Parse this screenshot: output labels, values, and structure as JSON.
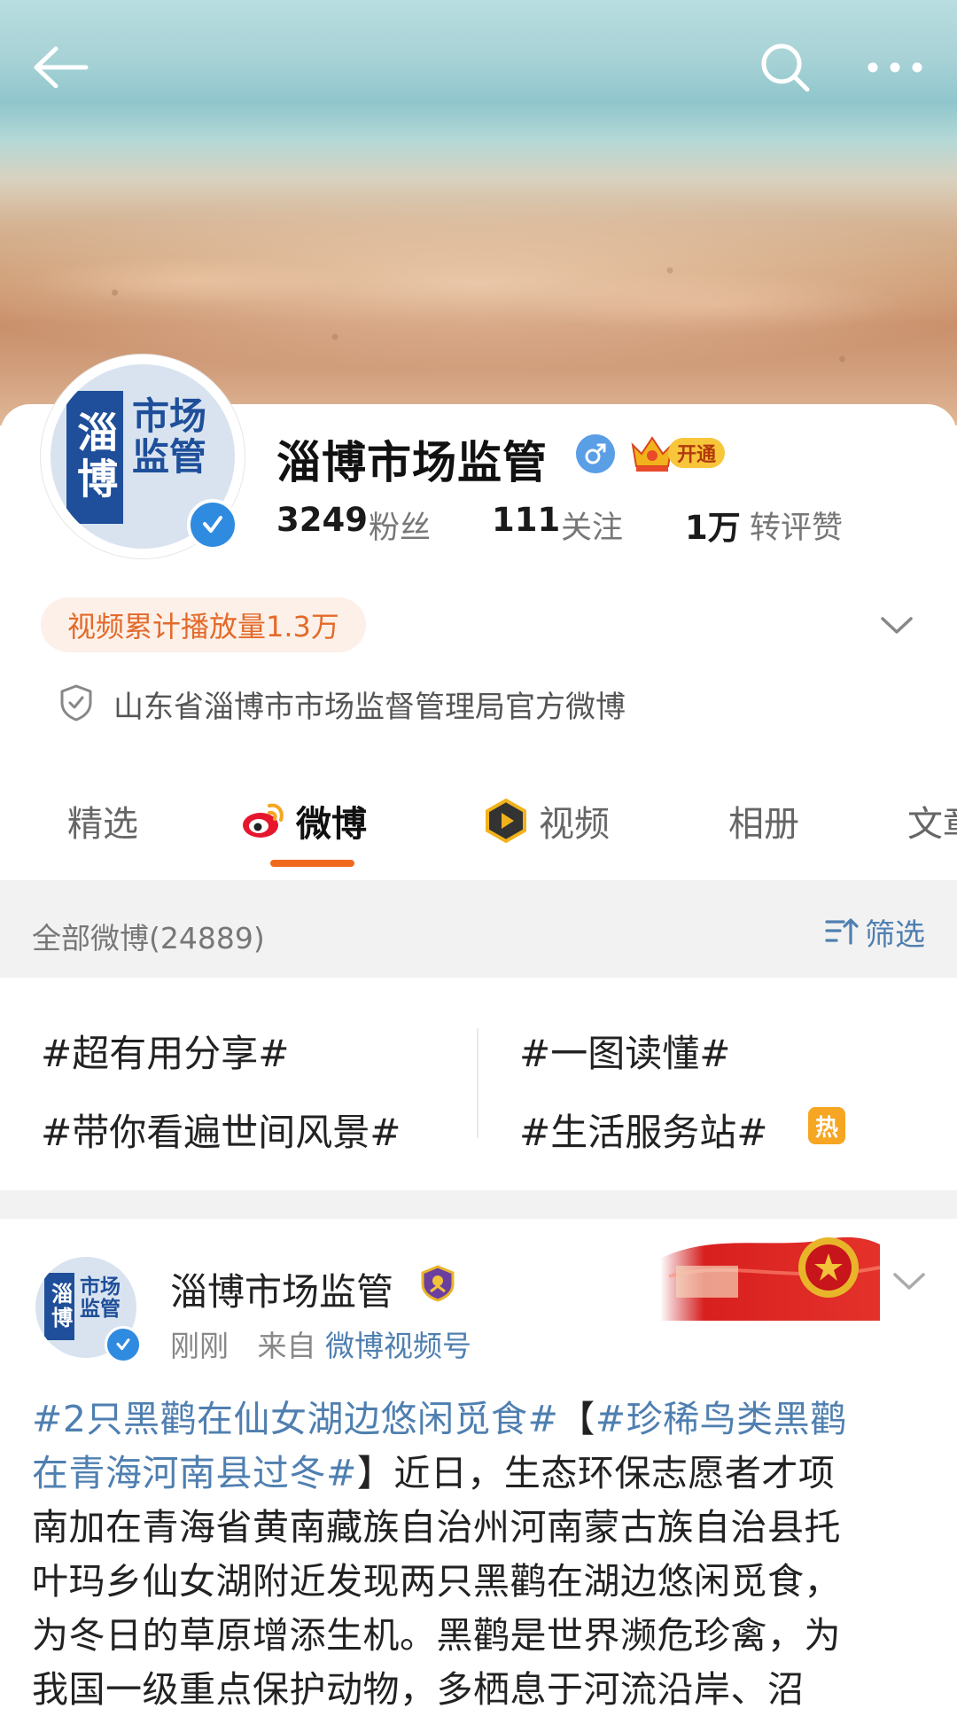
{
  "header": {
    "back_icon": "arrow-left-icon",
    "search_icon": "search-icon",
    "more_icon": "more-dots-icon"
  },
  "profile": {
    "avatar_logo_left": "淄博",
    "avatar_logo_right": "市场\n监管",
    "name": "淄博市场监管",
    "vip_label": "开通",
    "stats": [
      {
        "num": "3249",
        "label": "粉丝"
      },
      {
        "num": "111",
        "label": "关注"
      },
      {
        "num": "1万",
        "label": "转评赞"
      }
    ],
    "play_count": "视频累计播放量1.3万",
    "bio": "山东省淄博市市场监督管理局官方微博"
  },
  "tabs": [
    {
      "label": "精选",
      "active": false
    },
    {
      "label": "微博",
      "active": true
    },
    {
      "label": "视频",
      "active": false
    },
    {
      "label": "相册",
      "active": false
    },
    {
      "label": "文章",
      "active": false
    }
  ],
  "filter": {
    "title": "全部微博(24889)",
    "button": "筛选"
  },
  "topics": [
    "#超有用分享#",
    "#一图读懂#",
    "#带你看遍世间风景#",
    "#生活服务站#"
  ],
  "hot_badge": "热",
  "post": {
    "author": "淄博市场监管",
    "time": "刚刚",
    "from_label": "来自",
    "source": "微博视频号",
    "lines": [
      [
        {
          "t": "#2只黑鹳在仙女湖边悠闲觅食#",
          "link": true
        },
        {
          "t": "【",
          "link": false
        },
        {
          "t": "#珍稀鸟类黑鹳",
          "link": true
        }
      ],
      [
        {
          "t": "在青海河南县过冬#",
          "link": true
        },
        {
          "t": "】近日，生态环保志愿者才项",
          "link": false
        }
      ],
      [
        {
          "t": "南加在青海省黄南藏族自治州河南蒙古族自治县托",
          "link": false
        }
      ],
      [
        {
          "t": "叶玛乡仙女湖附近发现两只黑鹳在湖边悠闲觅食，",
          "link": false
        }
      ],
      [
        {
          "t": "为冬日的草原增添生机。黑鹳是世界濒危珍禽，为",
          "link": false
        }
      ],
      [
        {
          "t": "我国一级重点保护动物，多栖息于河流沿岸、沼",
          "link": false
        }
      ]
    ]
  },
  "colors": {
    "accent_orange": "#f06a1e",
    "link_blue": "#4f7fb0",
    "verify_blue": "#2f8be0",
    "logo_blue": "#1f4f9a"
  }
}
